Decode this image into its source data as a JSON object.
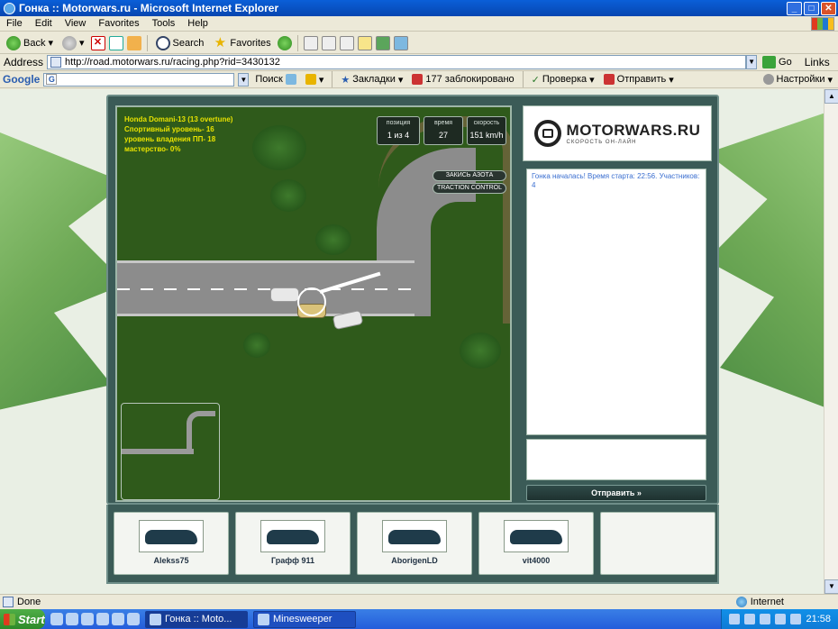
{
  "window": {
    "title": "Гонка :: Motorwars.ru - Microsoft Internet Explorer"
  },
  "menu": [
    "File",
    "Edit",
    "View",
    "Favorites",
    "Tools",
    "Help"
  ],
  "toolbar": {
    "back": "Back",
    "search": "Search",
    "favorites": "Favorites"
  },
  "address": {
    "label": "Address",
    "url": "http://road.motorwars.ru/racing.php?rid=3430132",
    "go": "Go",
    "links": "Links"
  },
  "googlebar": {
    "logo": "Google",
    "search": "Поиск",
    "bookmarks": "Закладки",
    "blocked": "177 заблокировано",
    "check": "Проверка",
    "send": "Отправить",
    "settings": "Настройки"
  },
  "game": {
    "player_info": {
      "car": "Honda Domani-13 (13 overtune)",
      "sport_level": "Спортивный уровень- 16",
      "skill_level": "уровень владения ПП- 18",
      "mastery": "мастерство- 0%"
    },
    "hud": {
      "position_label": "позиция",
      "position_value": "1 из 4",
      "time_label": "время",
      "time_value": "27",
      "speed_label": "скорость",
      "speed_value": "151 km/h"
    },
    "nitro_button": "ЗАКИСЬ АЗОТА",
    "traction_button": "TRACTION CONTROL"
  },
  "side": {
    "logo_title": "MOTORWARS.RU",
    "logo_sub": "СКОРОСТЬ ОН-ЛАЙН",
    "chat_message": "Гонка началась! Время старта: 22:56. Участников: 4",
    "send_button": "Отправить »"
  },
  "players": [
    "Alekss75",
    "Графф 911",
    "AborigenLD",
    "vit4000"
  ],
  "status": {
    "text": "Done",
    "zone": "Internet"
  },
  "taskbar": {
    "start": "Start",
    "items": [
      "Гонка :: Moto...",
      "Minesweeper"
    ],
    "clock": "21:58"
  }
}
